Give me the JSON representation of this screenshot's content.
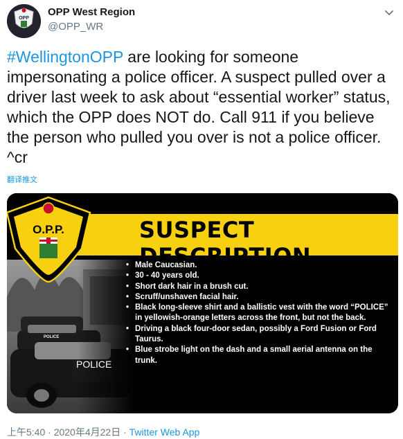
{
  "account": {
    "display_name": "OPP West Region",
    "handle": "@OPP_WR",
    "avatar_text": "OPP"
  },
  "tweet": {
    "hashtag": "#WellingtonOPP",
    "body": " are looking for someone impersonating a police officer.  A suspect pulled over a driver last week to ask about “essential worker” status, which the OPP does NOT do. Call 911 if you believe the person who pulled you over is not a police officer. ^cr",
    "translate_label": "翻译推文"
  },
  "image": {
    "logo_text": "O.P.P.",
    "headline": "SUSPECT DESCRIPTION",
    "car_label_1": "POLICE",
    "car_label_2": "POLICE",
    "bullets": [
      "Male Caucasian.",
      "30 - 40 years old.",
      "Short dark hair in a brush cut.",
      "Scruff/unshaven facial hair.",
      "Black long-sleeve shirt and a ballistic vest with the word “POLICE” in yellowish-orange letters across the front, but not the back.",
      "Driving a black four-door sedan, possibly a Ford Fusion or Ford Taurus.",
      "Blue strobe light on the dash and a small aerial antenna on the trunk."
    ],
    "colors": {
      "yellow": "#f7d10f",
      "black": "#000000",
      "logo_green": "#2f7d32",
      "logo_red": "#c8102e"
    }
  },
  "meta": {
    "time": "上午5:40",
    "sep": " · ",
    "date": "2020年4月22日",
    "sep2": " · ",
    "app": "Twitter Web App"
  },
  "colors": {
    "link": "#1b95e0",
    "muted": "#657786",
    "text": "#14171a"
  }
}
